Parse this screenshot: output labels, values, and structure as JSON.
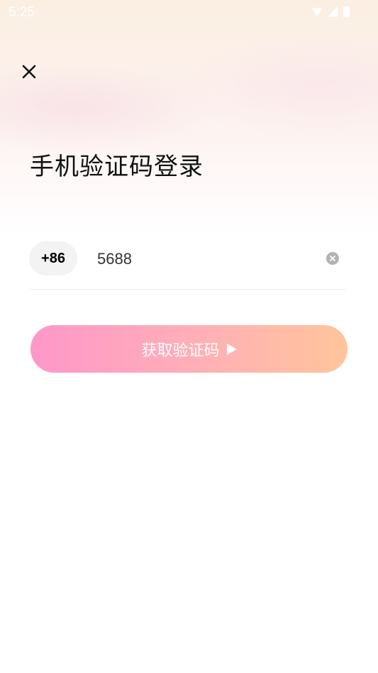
{
  "status_bar": {
    "time": "5:25"
  },
  "header": {
    "close_icon": "close-icon"
  },
  "title": "手机验证码登录",
  "phone": {
    "country_code": "+86",
    "value": "5688"
  },
  "actions": {
    "get_code_label": "获取验证码"
  },
  "colors": {
    "button_gradient_start": "#ff97c9",
    "button_gradient_end": "#ffc59a",
    "title_text": "#111111",
    "clear_icon": "#b3b3b3"
  }
}
